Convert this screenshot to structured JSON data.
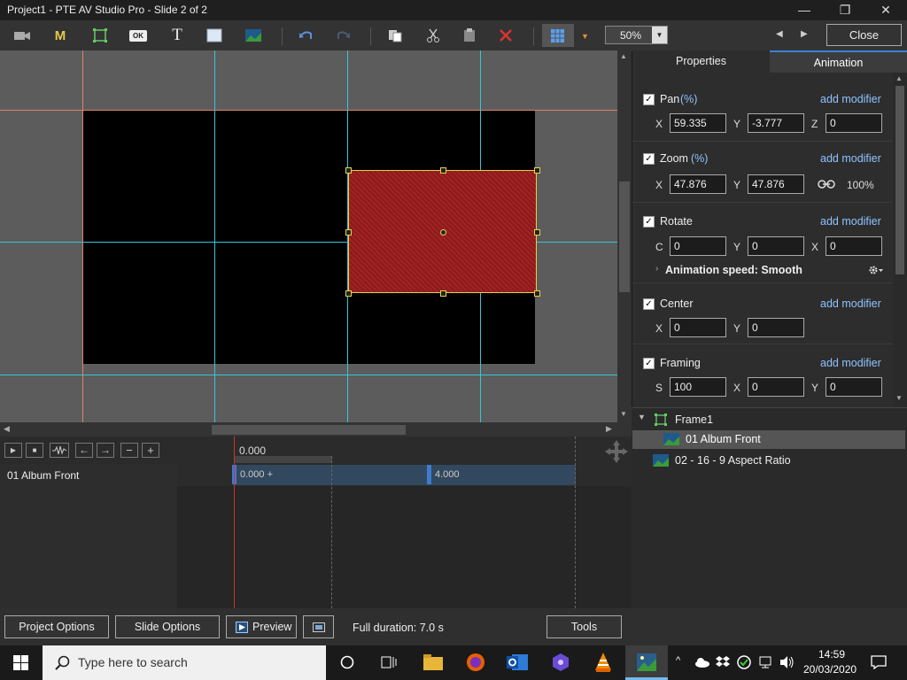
{
  "window": {
    "title": "Project1 - PTE AV Studio Pro - Slide 2 of 2"
  },
  "toolbar": {
    "zoom": "50%",
    "close_label": "Close",
    "text_tool_glyph": "T",
    "m_glyph": "M",
    "ok_glyph": "OK"
  },
  "panel": {
    "tabs": [
      "Properties",
      "Animation"
    ],
    "add_modifier": "add modifier",
    "pan": {
      "label": "Pan",
      "unit": "(%)",
      "x": "59.335",
      "y": "-3.777",
      "z": "0"
    },
    "zoom": {
      "label": "Zoom",
      "unit": "(%)",
      "x": "47.876",
      "y": "47.876",
      "pct": "100%"
    },
    "rotate": {
      "label": "Rotate",
      "c": "0",
      "y": "0",
      "x": "0"
    },
    "speed": "Animation speed: Smooth",
    "center": {
      "label": "Center",
      "x": "0",
      "y": "0"
    },
    "framing": {
      "label": "Framing",
      "s": "100",
      "x": "0",
      "y": "0"
    },
    "axis": {
      "x": "X",
      "y": "Y",
      "z": "Z",
      "c": "C",
      "s": "S"
    }
  },
  "tree": {
    "items": [
      "Frame1",
      "01 Album Front",
      "02 - 16 - 9 Aspect Ratio"
    ]
  },
  "timeline": {
    "time": "0.000",
    "track_name": "01 Album Front",
    "key1": "0.000 +",
    "key2": "4.000"
  },
  "bottom": {
    "project_options": "Project Options",
    "slide_options": "Slide Options",
    "preview": "Preview",
    "duration": "Full duration: 7.0 s",
    "tools": "Tools"
  },
  "taskbar": {
    "search_placeholder": "Type here to search",
    "time": "14:59",
    "date": "20/03/2020"
  }
}
